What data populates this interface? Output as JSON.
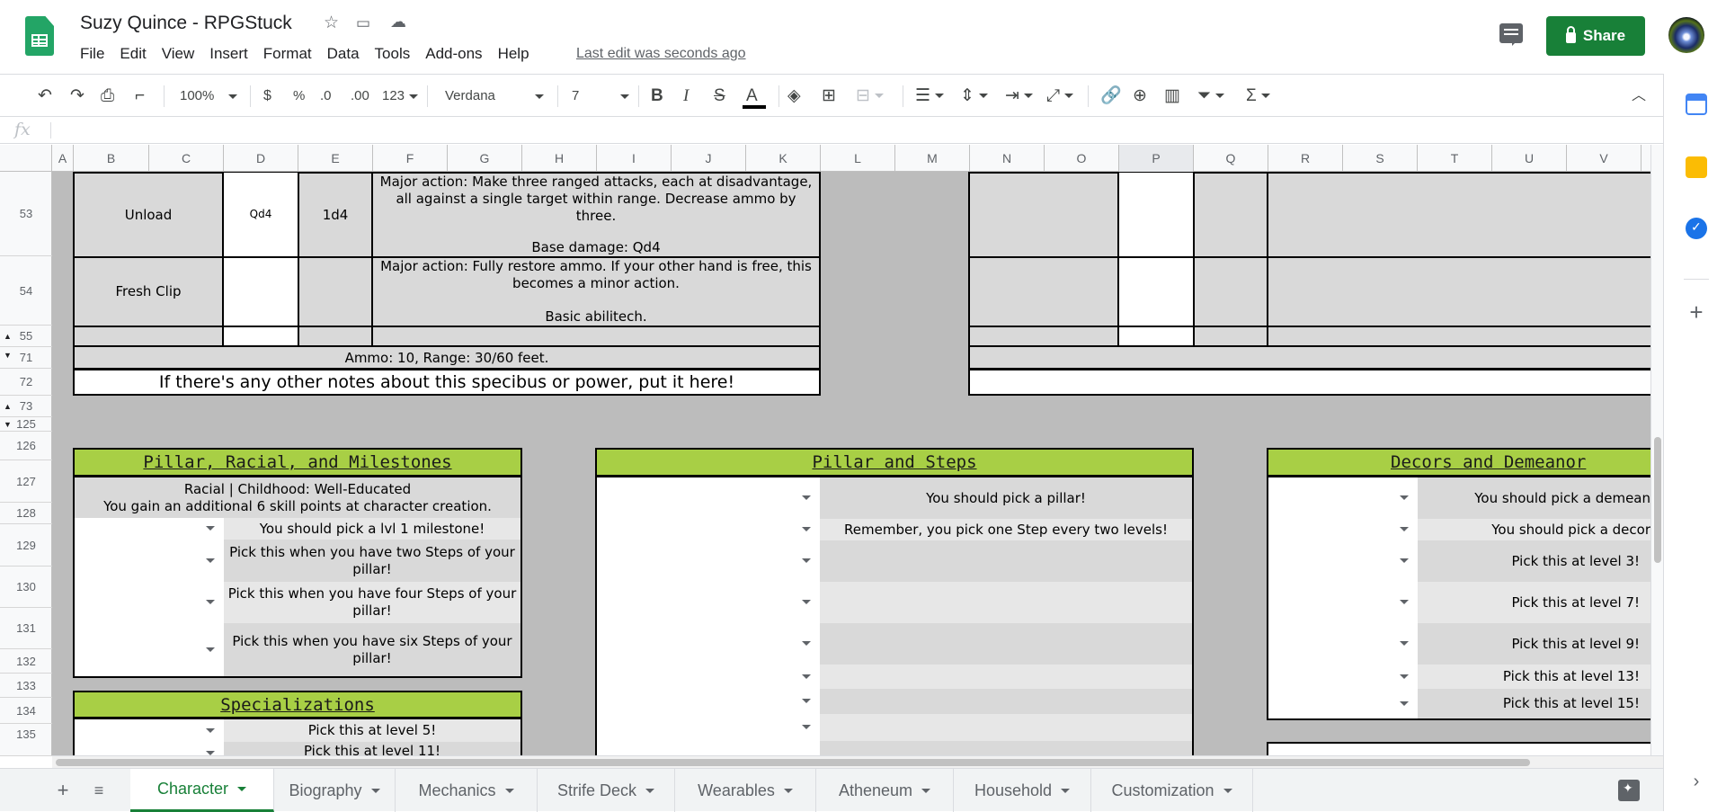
{
  "header": {
    "doc_title": "Suzy Quince - RPGStuck",
    "menus": [
      "File",
      "Edit",
      "View",
      "Insert",
      "Format",
      "Data",
      "Tools",
      "Add-ons",
      "Help"
    ],
    "last_edit": "Last edit was seconds ago",
    "share_label": "Share"
  },
  "toolbar": {
    "zoom": "100%",
    "currency": "$",
    "percent": "%",
    "decrease_decimal": ".0",
    "increase_decimal": ".00",
    "more_formats": "123",
    "font": "Verdana",
    "font_size": "7",
    "bold": "B",
    "italic": "I",
    "strike": "S",
    "text_color": "A"
  },
  "formula_bar": {
    "fx": "fx",
    "value": ""
  },
  "columns": [
    "A",
    "B",
    "C",
    "D",
    "E",
    "F",
    "G",
    "H",
    "I",
    "J",
    "K",
    "L",
    "M",
    "N",
    "O",
    "P",
    "Q",
    "R",
    "S",
    "T",
    "U",
    "V"
  ],
  "rows": [
    "53",
    "54",
    "55",
    "71",
    "72",
    "73",
    "125",
    "126",
    "127",
    "128",
    "129",
    "130",
    "131",
    "132",
    "133",
    "134",
    "135"
  ],
  "weapon": {
    "unload_name": "Unload",
    "unload_dmg": "Qd4",
    "unload_die": "1d4",
    "unload_desc": "Major action: Make three ranged attacks, each at disadvantage, all against a single target within range. Decrease ammo by three.",
    "unload_base": "Base damage: Qd4",
    "clip_name": "Fresh Clip",
    "clip_desc": "Major action: Fully restore ammo. If your other hand is free, this becomes a minor action.",
    "clip_basic": "Basic abilitech.",
    "ammo": "Ammo: 10, Range: 30/60 feet.",
    "notes": "If there's any other notes about this specibus or power, put it here!"
  },
  "pillar_racial": {
    "title": "Pillar, Racial, and Milestones",
    "racial_line1": "Racial | Childhood: Well-Educated",
    "racial_line2": "You gain an additional 6 skill points at character creation.",
    "rows": [
      "You should pick a lvl 1 milestone!",
      "Pick this when you have two Steps of your pillar!",
      "Pick this when you have four Steps of your pillar!",
      "Pick this when you have six Steps of your pillar!"
    ]
  },
  "specializations": {
    "title": "Specializations",
    "rows": [
      "Pick this at level 5!",
      "Pick this at level 11!"
    ]
  },
  "pillar_steps": {
    "title": "Pillar and Steps",
    "rows": [
      "You should pick a pillar!",
      "Remember, you pick one Step every two levels!"
    ]
  },
  "decors": {
    "title": "Decors and Demeanor",
    "rows": [
      "You should pick a demean",
      "You should pick a decor",
      "Pick this at level 3!",
      "Pick this at level 7!",
      "Pick this at level 9!",
      "Pick this at level 13!",
      "Pick this at level 15!"
    ]
  },
  "tabs": [
    "Character",
    "Biography",
    "Mechanics",
    "Strife Deck",
    "Wearables",
    "Atheneum",
    "Household",
    "Customization"
  ],
  "colors": {
    "accent_green": "#188038",
    "section_header": "#a8cf45",
    "cell_grey": "#d9d9d9",
    "background_grey": "#bcbcbc"
  }
}
